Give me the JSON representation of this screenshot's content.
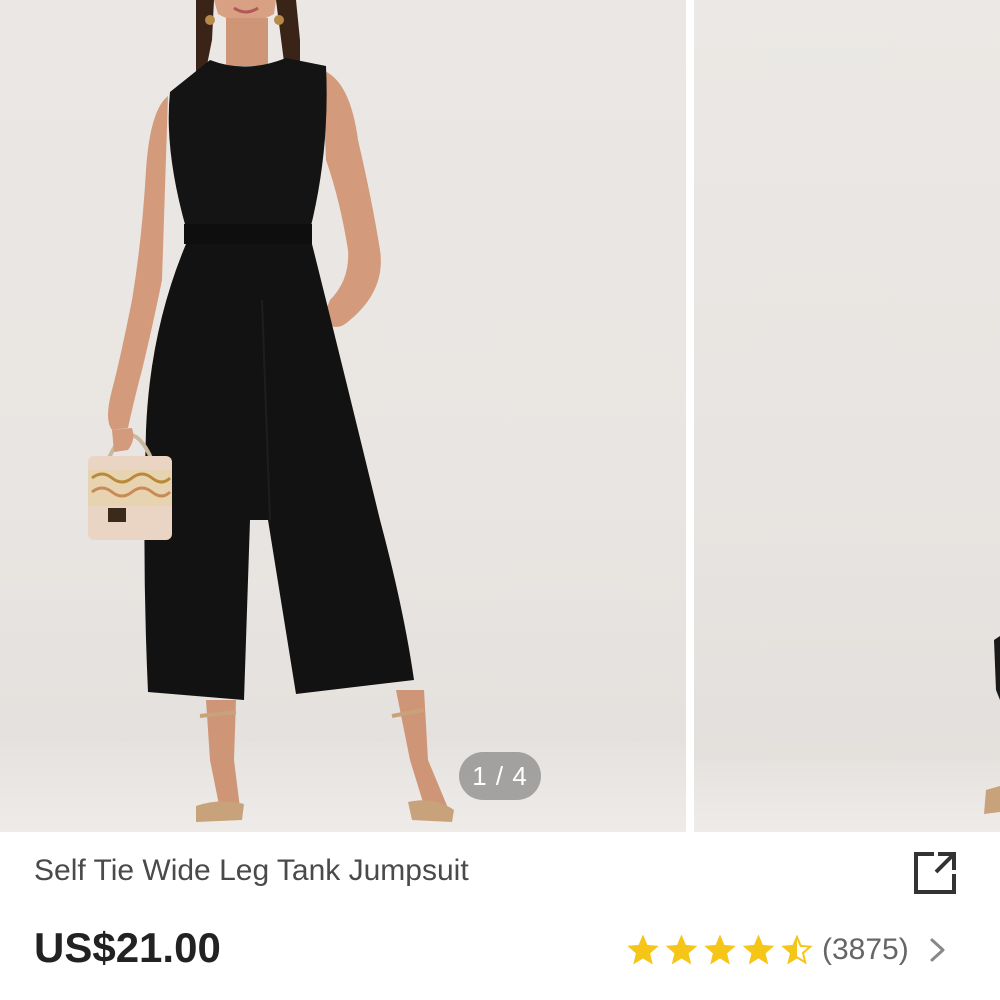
{
  "carousel": {
    "counter": "1 / 4",
    "current_image": 1,
    "total_images": 4
  },
  "product": {
    "title": "Self Tie Wide Leg Tank Jumpsuit",
    "price": "US$21.00"
  },
  "rating": {
    "stars": 4.5,
    "max_stars": 5,
    "review_count": "(3875)",
    "star_color": "#f5c518"
  },
  "icons": {
    "share": "share-external-icon",
    "chevron": "chevron-right-icon"
  }
}
